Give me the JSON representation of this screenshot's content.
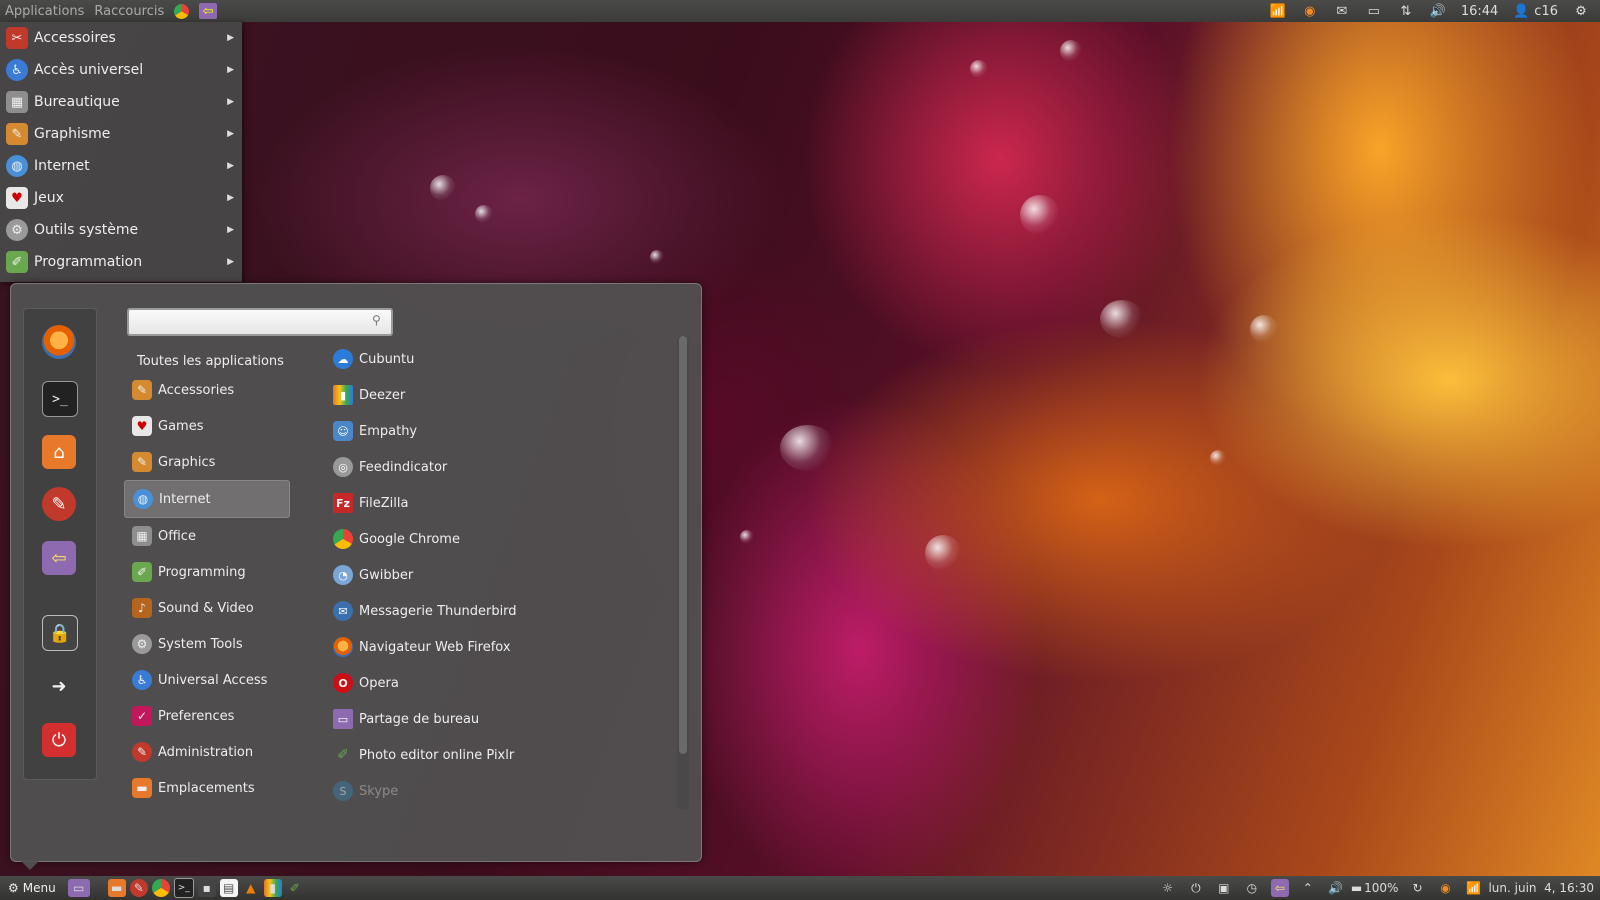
{
  "top_panel": {
    "applications_label": "Applications",
    "shortcuts_label": "Raccourcis",
    "time": "16:44",
    "user": "c16"
  },
  "category_menu": {
    "items": [
      {
        "label": "Accessoires",
        "icon": "accessories-icon",
        "color": "#c0392b"
      },
      {
        "label": "Accès universel",
        "icon": "universal-access-icon",
        "color": "#3a7bd5"
      },
      {
        "label": "Bureautique",
        "icon": "office-icon",
        "color": "#8e8e8e"
      },
      {
        "label": "Graphisme",
        "icon": "graphics-icon",
        "color": "#d58a2f"
      },
      {
        "label": "Internet",
        "icon": "internet-icon",
        "color": "#4a90d9"
      },
      {
        "label": "Jeux",
        "icon": "games-icon",
        "color": "#e8e8e8"
      },
      {
        "label": "Outils système",
        "icon": "gear-icon",
        "color": "#9a9a9a"
      },
      {
        "label": "Programmation",
        "icon": "programming-icon",
        "color": "#6aa84f"
      }
    ]
  },
  "main_menu": {
    "search": {
      "value": "",
      "placeholder": ""
    },
    "all_apps_label": "Toutes les applications",
    "categories": [
      {
        "label": "Accessories",
        "icon": "accessories-icon",
        "selected": false
      },
      {
        "label": "Games",
        "icon": "games-icon",
        "selected": false
      },
      {
        "label": "Graphics",
        "icon": "graphics-icon",
        "selected": false
      },
      {
        "label": "Internet",
        "icon": "internet-icon",
        "selected": true
      },
      {
        "label": "Office",
        "icon": "office-icon",
        "selected": false
      },
      {
        "label": "Programming",
        "icon": "programming-icon",
        "selected": false
      },
      {
        "label": "Sound & Video",
        "icon": "sound-video-icon",
        "selected": false
      },
      {
        "label": "System Tools",
        "icon": "gear-icon",
        "selected": false
      },
      {
        "label": "Universal Access",
        "icon": "universal-access-icon",
        "selected": false
      },
      {
        "label": "Preferences",
        "icon": "preferences-icon",
        "selected": false
      },
      {
        "label": "Administration",
        "icon": "administration-icon",
        "selected": false
      },
      {
        "label": "Emplacements",
        "icon": "folder-icon",
        "selected": false
      }
    ],
    "apps": [
      {
        "label": "Cubuntu",
        "icon": "cubuntu-icon",
        "color": "#2b7bd8"
      },
      {
        "label": "Deezer",
        "icon": "deezer-icon",
        "color": "#e6732a"
      },
      {
        "label": "Empathy",
        "icon": "empathy-icon",
        "color": "#4a86c8"
      },
      {
        "label": "Feedindicator",
        "icon": "feedindicator-icon",
        "color": "#999999"
      },
      {
        "label": "FileZilla",
        "icon": "filezilla-icon",
        "color": "#c62828"
      },
      {
        "label": "Google Chrome",
        "icon": "chrome-icon",
        "color": "#34a853"
      },
      {
        "label": "Gwibber",
        "icon": "gwibber-icon",
        "color": "#7aa7d6"
      },
      {
        "label": "Messagerie Thunderbird",
        "icon": "thunderbird-icon",
        "color": "#3a6fb0"
      },
      {
        "label": "Navigateur Web Firefox",
        "icon": "firefox-icon",
        "color": "#e66000"
      },
      {
        "label": "Opera",
        "icon": "opera-icon",
        "color": "#cc0f16"
      },
      {
        "label": "Partage de bureau",
        "icon": "desktop-share-icon",
        "color": "#8e6bb0"
      },
      {
        "label": "Photo editor online Pixlr",
        "icon": "pixlr-icon",
        "color": "#6aa84f"
      },
      {
        "label": "Skype",
        "icon": "skype-icon",
        "color": "#3a7ca5",
        "dim": true
      }
    ],
    "favorites": [
      {
        "icon": "firefox-icon",
        "color": "#e66000"
      },
      {
        "icon": "terminal-icon",
        "color": "#222222"
      },
      {
        "icon": "home-folder-icon",
        "color": "#e8782a"
      },
      {
        "icon": "settings-icon",
        "color": "#c0392b"
      },
      {
        "icon": "desktop-share-icon",
        "color": "#8e6bb0"
      },
      {
        "icon": "lock-screen-icon",
        "color": "#444444"
      },
      {
        "icon": "logout-icon",
        "color": "#e8782a"
      },
      {
        "icon": "shutdown-icon",
        "color": "#d32f2f"
      }
    ]
  },
  "bottom_panel": {
    "menu_label": "Menu",
    "battery": "100%",
    "datetime": "lun. juin  4, 16:30"
  }
}
